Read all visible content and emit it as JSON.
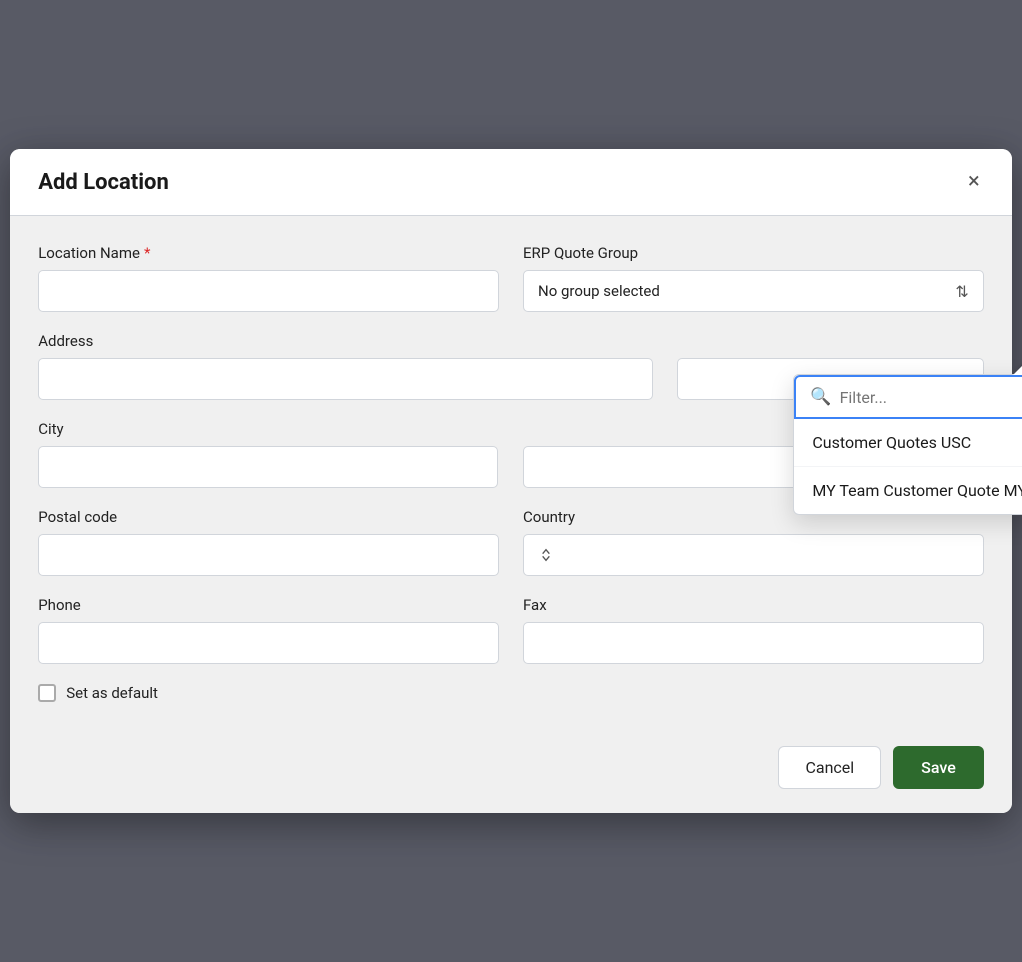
{
  "dialog": {
    "title": "Add Location",
    "close_label": "×"
  },
  "form": {
    "location_name_label": "Location Name",
    "location_name_required": "*",
    "location_name_placeholder": "",
    "erp_group_label": "ERP Quote Group",
    "erp_group_selected": "No group selected",
    "address_label": "Address",
    "address_placeholder": "",
    "city_label": "City",
    "city_placeholder": "",
    "postal_code_label": "Postal code",
    "postal_code_placeholder": "",
    "country_label": "Country",
    "country_placeholder": "",
    "phone_label": "Phone",
    "phone_placeholder": "",
    "fax_label": "Fax",
    "fax_placeholder": "",
    "set_default_label": "Set as default"
  },
  "dropdown": {
    "filter_placeholder": "Filter...",
    "items": [
      {
        "label": "Customer Quotes USC"
      },
      {
        "label": "MY Team Customer Quote MYQ"
      }
    ]
  },
  "footer": {
    "cancel_label": "Cancel",
    "save_label": "Save"
  }
}
